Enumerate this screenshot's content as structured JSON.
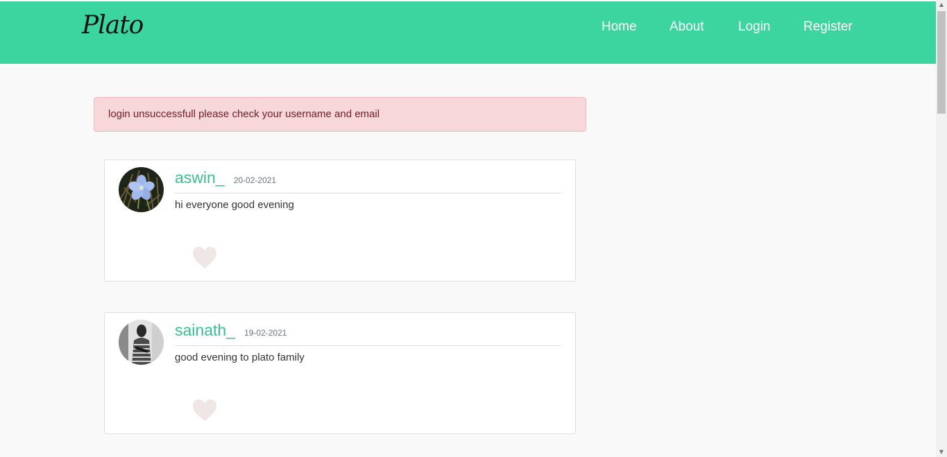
{
  "navbar": {
    "brand": "Plato",
    "links": [
      "Home",
      "About",
      "Login",
      "Register"
    ],
    "background": "#3cd5a0"
  },
  "alert": {
    "message": "login unsuccessfull please check your username and email"
  },
  "posts": [
    {
      "author": "aswin_",
      "date": "20-02-2021",
      "content": "hi everyone good evening",
      "avatar_icon": "flower-avatar",
      "like_icon": "heart-icon"
    },
    {
      "author": "sainath_",
      "date": "19-02-2021",
      "content": "good evening to plato family",
      "avatar_icon": "person-avatar",
      "like_icon": "heart-icon"
    }
  ],
  "colors": {
    "accent": "#3cbf90",
    "alert_bg": "#f8d7da",
    "alert_text": "#721c24",
    "heart": "#efe6e6"
  }
}
